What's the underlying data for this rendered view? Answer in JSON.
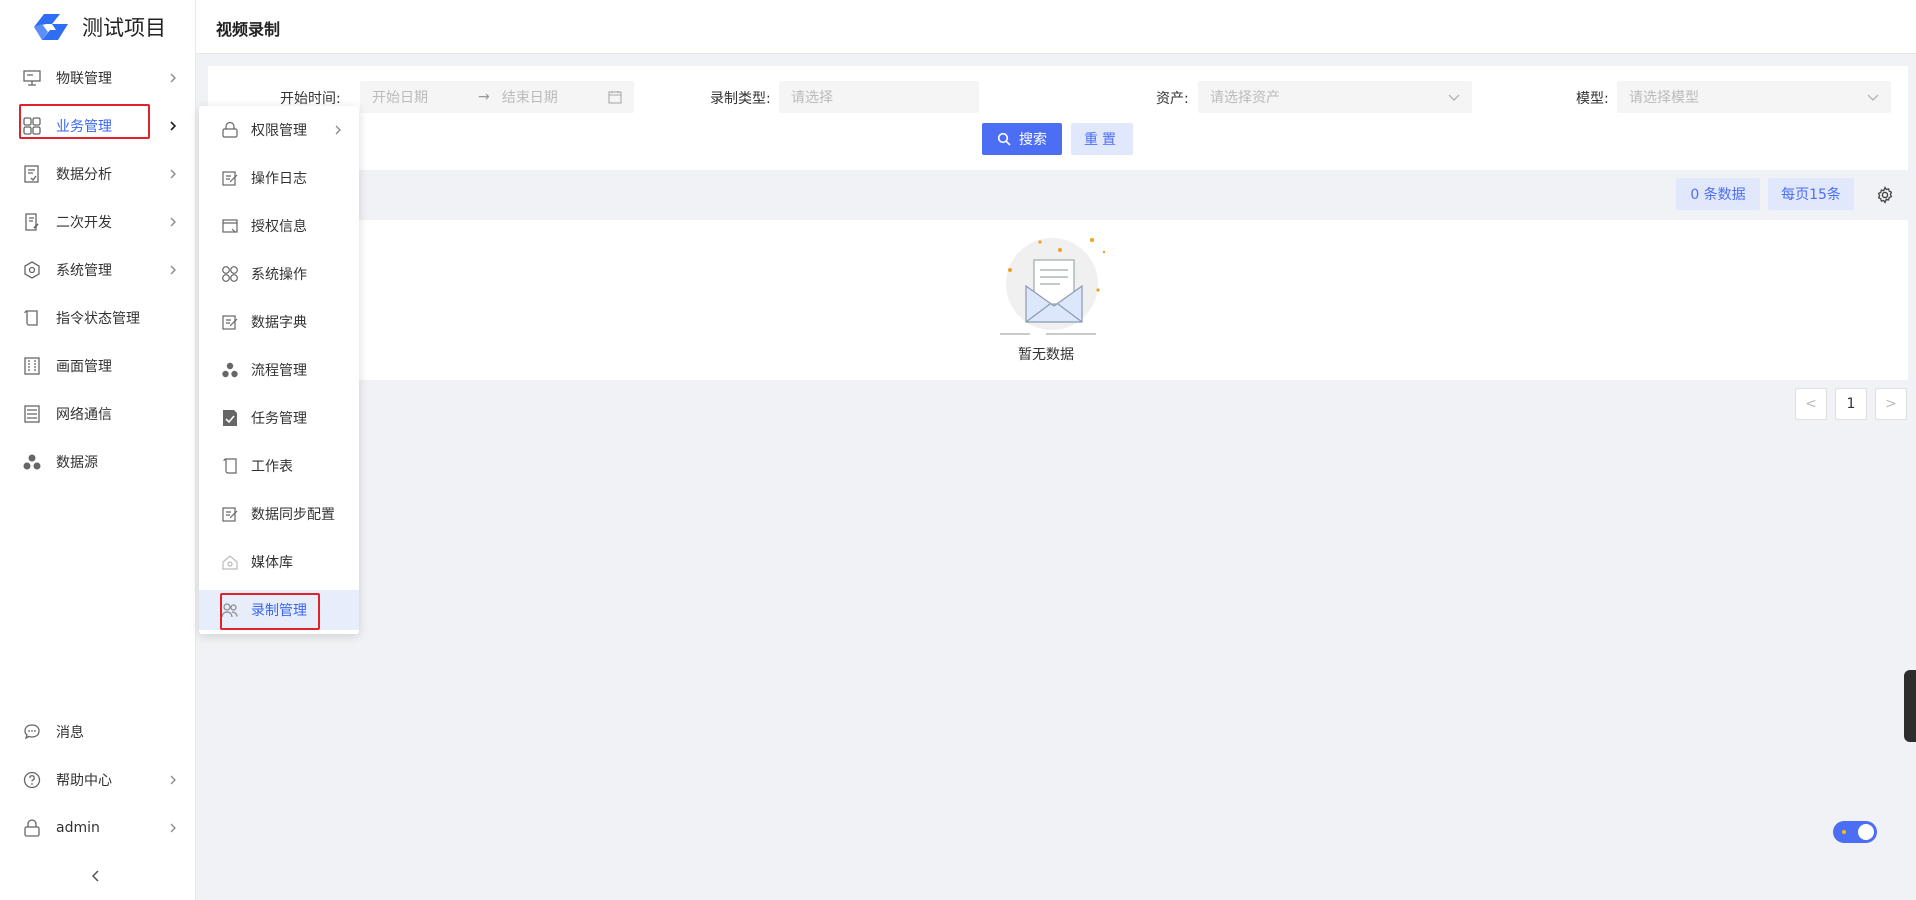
{
  "app": {
    "brand": "测试项目"
  },
  "header": {
    "title": "视频录制"
  },
  "sidebar": {
    "items": [
      {
        "label": "物联管理",
        "icon": "monitor-icon",
        "has_children": true
      },
      {
        "label": "业务管理",
        "icon": "grid-icon",
        "has_children": true,
        "active": true
      },
      {
        "label": "数据分析",
        "icon": "report-icon",
        "has_children": true
      },
      {
        "label": "二次开发",
        "icon": "doc-edit-icon",
        "has_children": true
      },
      {
        "label": "系统管理",
        "icon": "gear-icon",
        "has_children": true
      },
      {
        "label": "指令状态管理",
        "icon": "scroll-icon",
        "has_children": false
      },
      {
        "label": "画面管理",
        "icon": "building-icon",
        "has_children": false
      },
      {
        "label": "网络通信",
        "icon": "list-icon",
        "has_children": false
      },
      {
        "label": "数据源",
        "icon": "cluster-icon",
        "has_children": false
      }
    ],
    "bottom": [
      {
        "label": "消息",
        "icon": "chat-icon",
        "has_children": false
      },
      {
        "label": "帮助中心",
        "icon": "help-icon",
        "has_children": true
      },
      {
        "label": "admin",
        "icon": "lock-icon",
        "has_children": true
      }
    ]
  },
  "submenu": {
    "items": [
      {
        "label": "权限管理",
        "icon": "lock-icon",
        "has_children": true
      },
      {
        "label": "操作日志",
        "icon": "edit-icon"
      },
      {
        "label": "授权信息",
        "icon": "window-icon"
      },
      {
        "label": "系统操作",
        "icon": "circles-icon"
      },
      {
        "label": "数据字典",
        "icon": "edit-icon"
      },
      {
        "label": "流程管理",
        "icon": "cluster-icon"
      },
      {
        "label": "任务管理",
        "icon": "check-doc-icon"
      },
      {
        "label": "工作表",
        "icon": "scroll-icon"
      },
      {
        "label": "数据同步配置",
        "icon": "edit-icon"
      },
      {
        "label": "媒体库",
        "icon": "media-icon"
      },
      {
        "label": "录制管理",
        "icon": "users-icon",
        "selected": true
      }
    ]
  },
  "filters": {
    "start_time_label": "开始时间:",
    "start_placeholder": "开始日期",
    "range_sep": "→",
    "end_placeholder": "结束日期",
    "record_type_label": "录制类型:",
    "record_type_placeholder": "请选择",
    "asset_label": "资产:",
    "asset_placeholder": "请选择资产",
    "model_label": "模型:",
    "model_placeholder": "请选择模型",
    "search_label": "搜索",
    "reset_label": "重置"
  },
  "table": {
    "count_label": "0 条数据",
    "page_size_label": "每页15条",
    "empty_text": "暂无数据"
  },
  "pagination": {
    "prev": "<",
    "current": "1",
    "next": ">"
  },
  "colors": {
    "accent": "#4c6ef5",
    "highlight_border": "#e0232a",
    "selected_bg": "#e8edfc"
  }
}
